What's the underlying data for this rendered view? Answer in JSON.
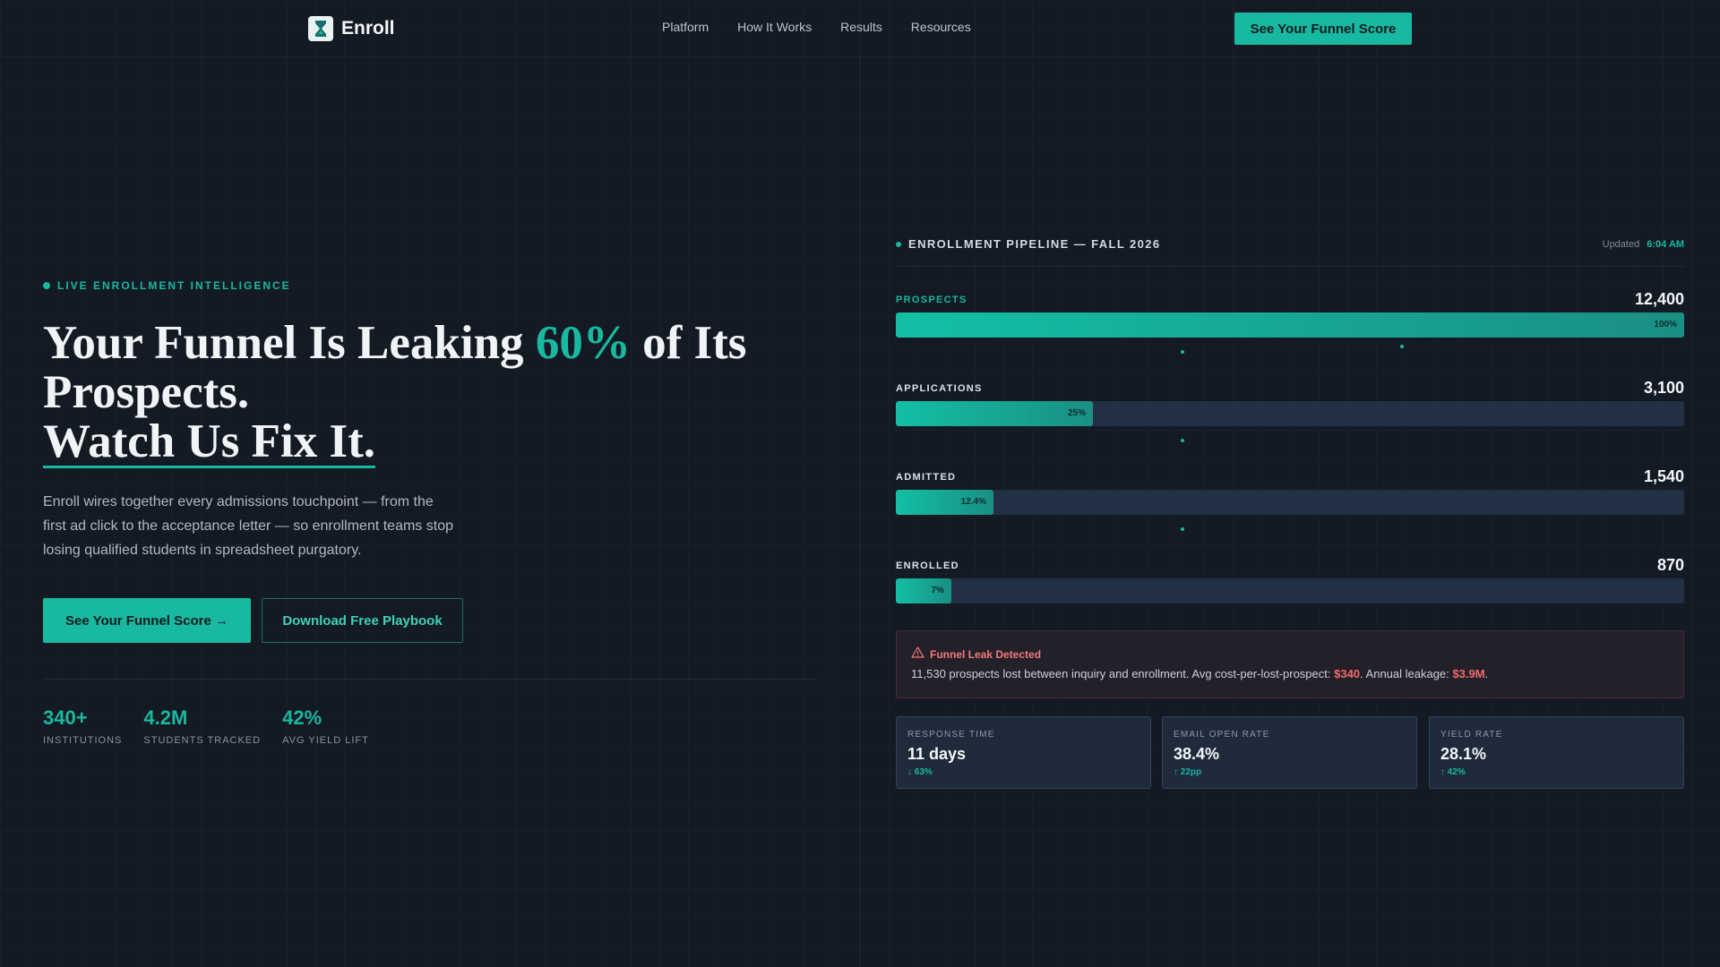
{
  "nav": {
    "brand": "Enroll",
    "links": [
      "Platform",
      "How It Works",
      "Results",
      "Resources"
    ],
    "cta": "See Your Funnel Score"
  },
  "hero": {
    "eyebrow": "LIVE ENROLLMENT INTELLIGENCE",
    "headline_pre": "Your Funnel Is Leaking ",
    "headline_accent": "60%",
    "headline_post": " of Its Prospects.",
    "headline_line2": "Watch Us Fix It.",
    "subtext": "Enroll wires together every admissions touchpoint — from the first ad click to the acceptance letter — so enrollment teams stop losing qualified students in spreadsheet purgatory.",
    "primary_cta": "See Your Funnel Score →",
    "secondary_cta": "Download Free Playbook",
    "stats": [
      {
        "value": "340+",
        "label": "INSTITUTIONS"
      },
      {
        "value": "4.2M",
        "label": "STUDENTS TRACKED"
      },
      {
        "value": "42%",
        "label": "AVG YIELD LIFT"
      }
    ]
  },
  "panel": {
    "title": "ENROLLMENT PIPELINE — FALL 2026",
    "updated_label": "Updated",
    "updated_time": "6:04 AM",
    "stages": [
      {
        "label": "PROSPECTS",
        "count": "12,400",
        "pct": "100%",
        "fraction": 1.0
      },
      {
        "label": "APPLICATIONS",
        "count": "3,100",
        "pct": "25%",
        "fraction": 0.25
      },
      {
        "label": "ADMITTED",
        "count": "1,540",
        "pct": "12.4%",
        "fraction": 0.124
      },
      {
        "label": "ENROLLED",
        "count": "870",
        "pct": "7%",
        "fraction": 0.07
      }
    ],
    "alert": {
      "title": "Funnel Leak Detected",
      "body_1": "11,530 prospects lost between inquiry and enrollment. Avg cost-per-lost-prospect: ",
      "cost": "$340",
      "body_2": ". Annual leakage: ",
      "leakage": "$3.9M",
      "body_3": "."
    },
    "metrics": [
      {
        "label": "RESPONSE TIME",
        "value": "11 days",
        "delta": "↓ 63%"
      },
      {
        "label": "EMAIL OPEN RATE",
        "value": "38.4%",
        "delta": "↑ 22pp"
      },
      {
        "label": "YIELD RATE",
        "value": "28.1%",
        "delta": "↑ 42%"
      }
    ]
  },
  "colors": {
    "accent": "#19b8a0",
    "background": "#141a24",
    "alert": "#f06a6a"
  }
}
